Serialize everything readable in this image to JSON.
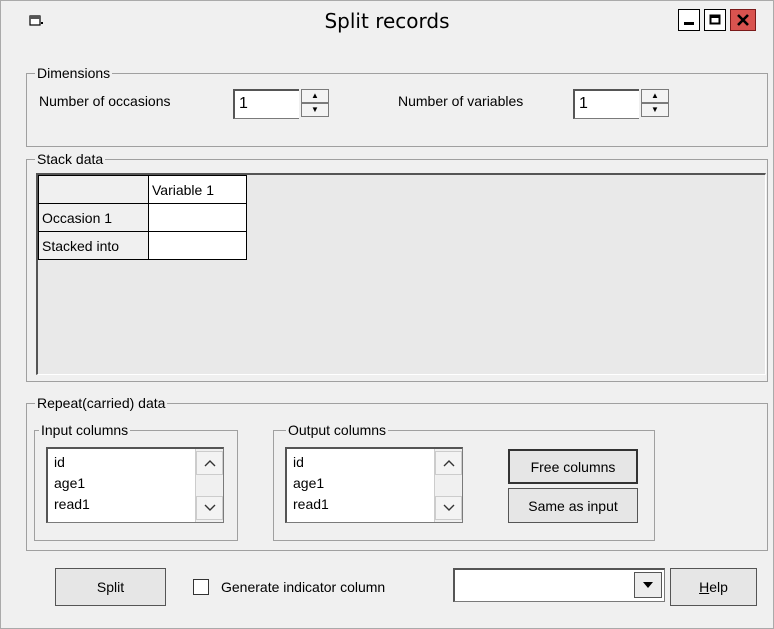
{
  "window": {
    "title": "Split records"
  },
  "dimensions": {
    "legend": "Dimensions",
    "occasions_label": "Number of occasions",
    "occasions_value": "1",
    "variables_label": "Number of variables",
    "variables_value": "1"
  },
  "stack": {
    "legend": "Stack data",
    "header": "Variable  1",
    "rows": [
      "Occasion 1",
      "Stacked into"
    ]
  },
  "repeat": {
    "legend": "Repeat(carried) data",
    "input_legend": "Input columns",
    "input_items": [
      "id",
      "age1",
      "read1"
    ],
    "output_legend": "Output columns",
    "output_items": [
      "id",
      "age1",
      "read1"
    ],
    "free_columns": "Free columns",
    "same_as_input": "Same as input"
  },
  "footer": {
    "split": "Split",
    "indicator_label": "Generate indicator column",
    "indicator_value": "",
    "help": "Help"
  }
}
